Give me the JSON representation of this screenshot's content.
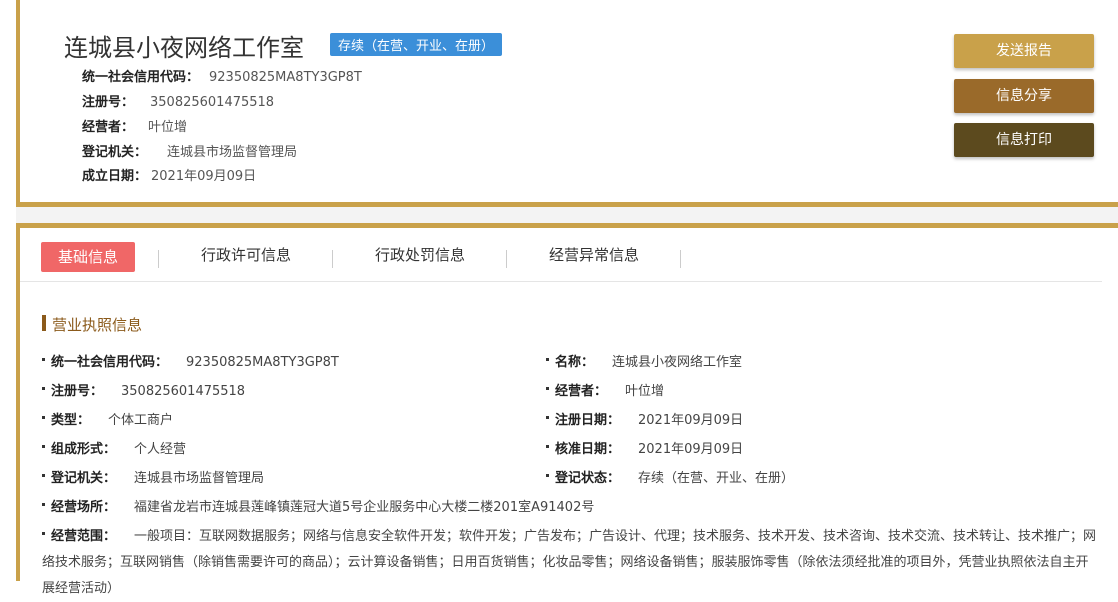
{
  "header": {
    "company_name": "连城县小夜网络工作室",
    "status_badge": "存续（在营、开业、在册）",
    "credit_code_label": "统一社会信用代码：",
    "credit_code": "92350825MA8TY3GP8T",
    "reg_no_label": "注册号：",
    "reg_no": "350825601475518",
    "operator_label": "经营者：",
    "operator": "叶位增",
    "authority_label": "登记机关：",
    "authority": "连城县市场监督管理局",
    "est_date_label": "成立日期：",
    "est_date": "2021年09月09日"
  },
  "buttons": {
    "report": "发送报告",
    "share": "信息分享",
    "print": "信息打印"
  },
  "tabs": [
    {
      "label": "基础信息",
      "active": true
    },
    {
      "label": "行政许可信息",
      "active": false
    },
    {
      "label": "行政处罚信息",
      "active": false
    },
    {
      "label": "经营异常信息",
      "active": false
    }
  ],
  "section": {
    "title": "营业执照信息"
  },
  "fields": {
    "credit_code": {
      "label": "统一社会信用代码：",
      "value": "92350825MA8TY3GP8T"
    },
    "name": {
      "label": "名称：",
      "value": "连城县小夜网络工作室"
    },
    "reg_no": {
      "label": "注册号：",
      "value": "350825601475518"
    },
    "operator": {
      "label": "经营者：",
      "value": "叶位增"
    },
    "type": {
      "label": "类型：",
      "value": "个体工商户"
    },
    "reg_date": {
      "label": "注册日期：",
      "value": "2021年09月09日"
    },
    "form": {
      "label": "组成形式：",
      "value": "个人经营"
    },
    "approve_date": {
      "label": "核准日期：",
      "value": "2021年09月09日"
    },
    "authority": {
      "label": "登记机关：",
      "value": "连城县市场监督管理局"
    },
    "reg_status": {
      "label": "登记状态：",
      "value": "存续（在营、开业、在册）"
    },
    "address": {
      "label": "经营场所：",
      "value": "福建省龙岩市连城县莲峰镇莲冠大道5号企业服务中心大楼二楼201室A91402号"
    },
    "scope": {
      "label": "经营范围：",
      "value": "一般项目：互联网数据服务；网络与信息安全软件开发；软件开发；广告发布；广告设计、代理；技术服务、技术开发、技术咨询、技术交流、技术转让、技术推广；网络技术服务；互联网销售（除销售需要许可的商品）；云计算设备销售；日用百货销售；化妆品零售；网络设备销售；服装服饰零售（除依法须经批准的项目外，凭营业执照依法自主开展经营活动）"
    }
  },
  "colors": {
    "accent": "#c9a14a",
    "badge": "#3b8fd9",
    "tab_active": "#f06767",
    "section_title": "#8b5a1b"
  }
}
